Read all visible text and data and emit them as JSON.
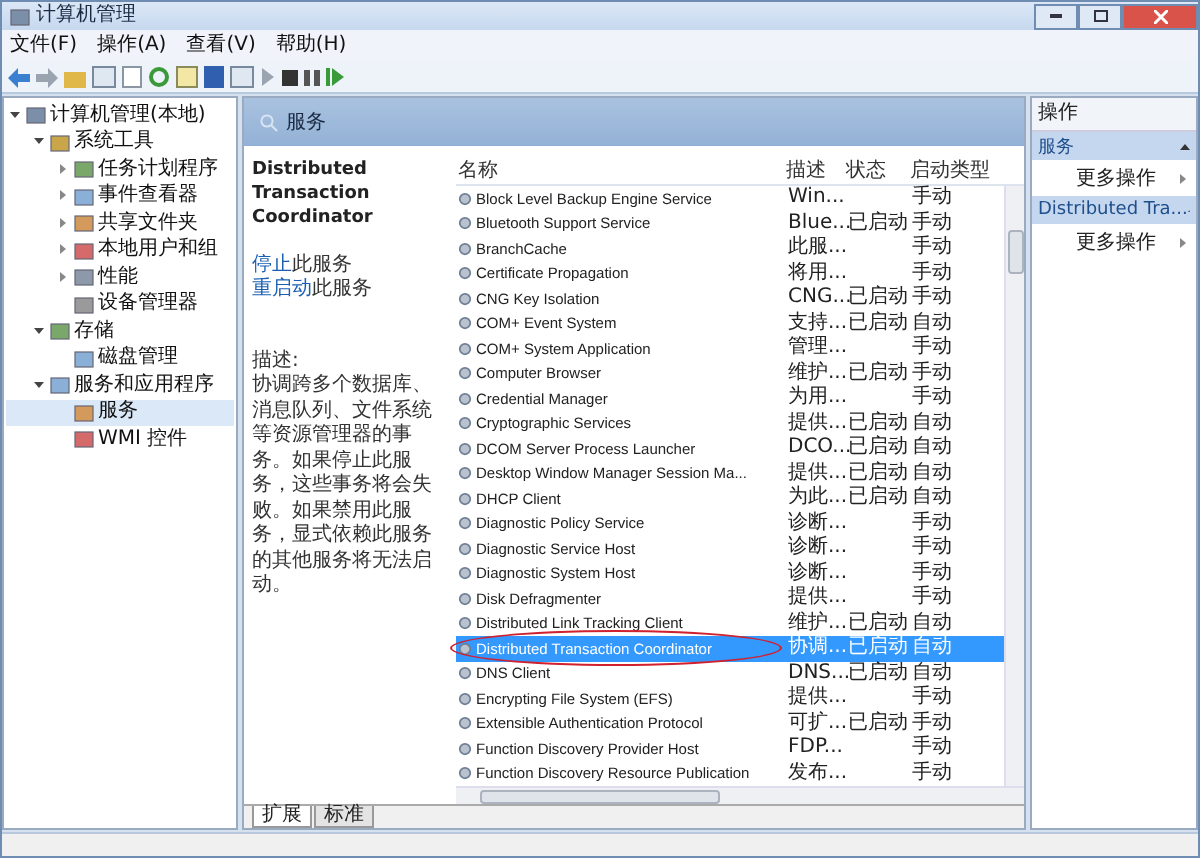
{
  "window": {
    "title": "计算机管理"
  },
  "menu": [
    "文件(F)",
    "操作(A)",
    "查看(V)",
    "帮助(H)"
  ],
  "tree": [
    {
      "label": "计算机管理(本地)",
      "expanded": true,
      "selected": false,
      "children": [
        {
          "label": "系统工具",
          "expanded": true,
          "selected": false,
          "children": [
            {
              "label": "任务计划程序",
              "expanded": false,
              "selected": false
            },
            {
              "label": "事件查看器",
              "expanded": false,
              "selected": false
            },
            {
              "label": "共享文件夹",
              "expanded": false,
              "selected": false
            },
            {
              "label": "本地用户和组",
              "expanded": false,
              "selected": false
            },
            {
              "label": "性能",
              "expanded": false,
              "selected": false
            },
            {
              "label": "设备管理器",
              "selected": false
            }
          ]
        },
        {
          "label": "存储",
          "expanded": true,
          "selected": false,
          "children": [
            {
              "label": "磁盘管理",
              "selected": false
            }
          ]
        },
        {
          "label": "服务和应用程序",
          "expanded": true,
          "selected": false,
          "children": [
            {
              "label": "服务",
              "selected": true
            },
            {
              "label": "WMI 控件",
              "selected": false
            }
          ]
        }
      ]
    }
  ],
  "panel": {
    "title": "服务"
  },
  "detail": {
    "title": "Distributed Transaction Coordinator",
    "links": [
      {
        "link": "停止",
        "rest": "此服务"
      },
      {
        "link": "重启动",
        "rest": "此服务"
      }
    ],
    "description_label": "描述:",
    "description": "协调跨多个数据库、消息队列、文件系统等资源管理器的事务。如果停止此服务，这些事务将会失败。如果禁用此服务，显式依赖此服务的其他服务将无法启动。"
  },
  "table": {
    "columns": [
      "名称",
      "描述",
      "状态",
      "启动类型"
    ],
    "rows": [
      {
        "name": "Block Level Backup Engine Service",
        "desc": "Win...",
        "status": "",
        "startup": "手动",
        "selected": false
      },
      {
        "name": "Bluetooth Support Service",
        "desc": "Blue...",
        "status": "已启动",
        "startup": "手动",
        "selected": false
      },
      {
        "name": "BranchCache",
        "desc": "此服...",
        "status": "",
        "startup": "手动",
        "selected": false
      },
      {
        "name": "Certificate Propagation",
        "desc": "将用...",
        "status": "",
        "startup": "手动",
        "selected": false
      },
      {
        "name": "CNG Key Isolation",
        "desc": "CNG...",
        "status": "已启动",
        "startup": "手动",
        "selected": false
      },
      {
        "name": "COM+ Event System",
        "desc": "支持...",
        "status": "已启动",
        "startup": "自动",
        "selected": false
      },
      {
        "name": "COM+ System Application",
        "desc": "管理...",
        "status": "",
        "startup": "手动",
        "selected": false
      },
      {
        "name": "Computer Browser",
        "desc": "维护...",
        "status": "已启动",
        "startup": "手动",
        "selected": false
      },
      {
        "name": "Credential Manager",
        "desc": "为用...",
        "status": "",
        "startup": "手动",
        "selected": false
      },
      {
        "name": "Cryptographic Services",
        "desc": "提供...",
        "status": "已启动",
        "startup": "自动",
        "selected": false
      },
      {
        "name": "DCOM Server Process Launcher",
        "desc": "DCO...",
        "status": "已启动",
        "startup": "自动",
        "selected": false
      },
      {
        "name": "Desktop Window Manager Session Ma...",
        "desc": "提供...",
        "status": "已启动",
        "startup": "自动",
        "selected": false
      },
      {
        "name": "DHCP Client",
        "desc": "为此...",
        "status": "已启动",
        "startup": "自动",
        "selected": false
      },
      {
        "name": "Diagnostic Policy Service",
        "desc": "诊断...",
        "status": "",
        "startup": "手动",
        "selected": false
      },
      {
        "name": "Diagnostic Service Host",
        "desc": "诊断...",
        "status": "",
        "startup": "手动",
        "selected": false
      },
      {
        "name": "Diagnostic System Host",
        "desc": "诊断...",
        "status": "",
        "startup": "手动",
        "selected": false
      },
      {
        "name": "Disk Defragmenter",
        "desc": "提供...",
        "status": "",
        "startup": "手动",
        "selected": false
      },
      {
        "name": "Distributed Link Tracking Client",
        "desc": "维护...",
        "status": "已启动",
        "startup": "自动",
        "selected": false
      },
      {
        "name": "Distributed Transaction Coordinator",
        "desc": "协调...",
        "status": "已启动",
        "startup": "自动",
        "selected": true,
        "circled": true
      },
      {
        "name": "DNS Client",
        "desc": "DNS...",
        "status": "已启动",
        "startup": "自动",
        "selected": false
      },
      {
        "name": "Encrypting File System (EFS)",
        "desc": "提供...",
        "status": "",
        "startup": "手动",
        "selected": false
      },
      {
        "name": "Extensible Authentication Protocol",
        "desc": "可扩...",
        "status": "已启动",
        "startup": "手动",
        "selected": false
      },
      {
        "name": "Function Discovery Provider Host",
        "desc": "FDP...",
        "status": "",
        "startup": "手动",
        "selected": false
      },
      {
        "name": "Function Discovery Resource Publication",
        "desc": "发布...",
        "status": "",
        "startup": "手动",
        "selected": false
      }
    ]
  },
  "tabs": [
    {
      "label": "扩展",
      "selected": true
    },
    {
      "label": "标准",
      "selected": false
    }
  ],
  "actions": {
    "title": "操作",
    "sections": [
      {
        "title": "服务",
        "items": [
          "更多操作"
        ]
      },
      {
        "title": "Distributed Tra...",
        "items": [
          "更多操作"
        ]
      }
    ]
  }
}
